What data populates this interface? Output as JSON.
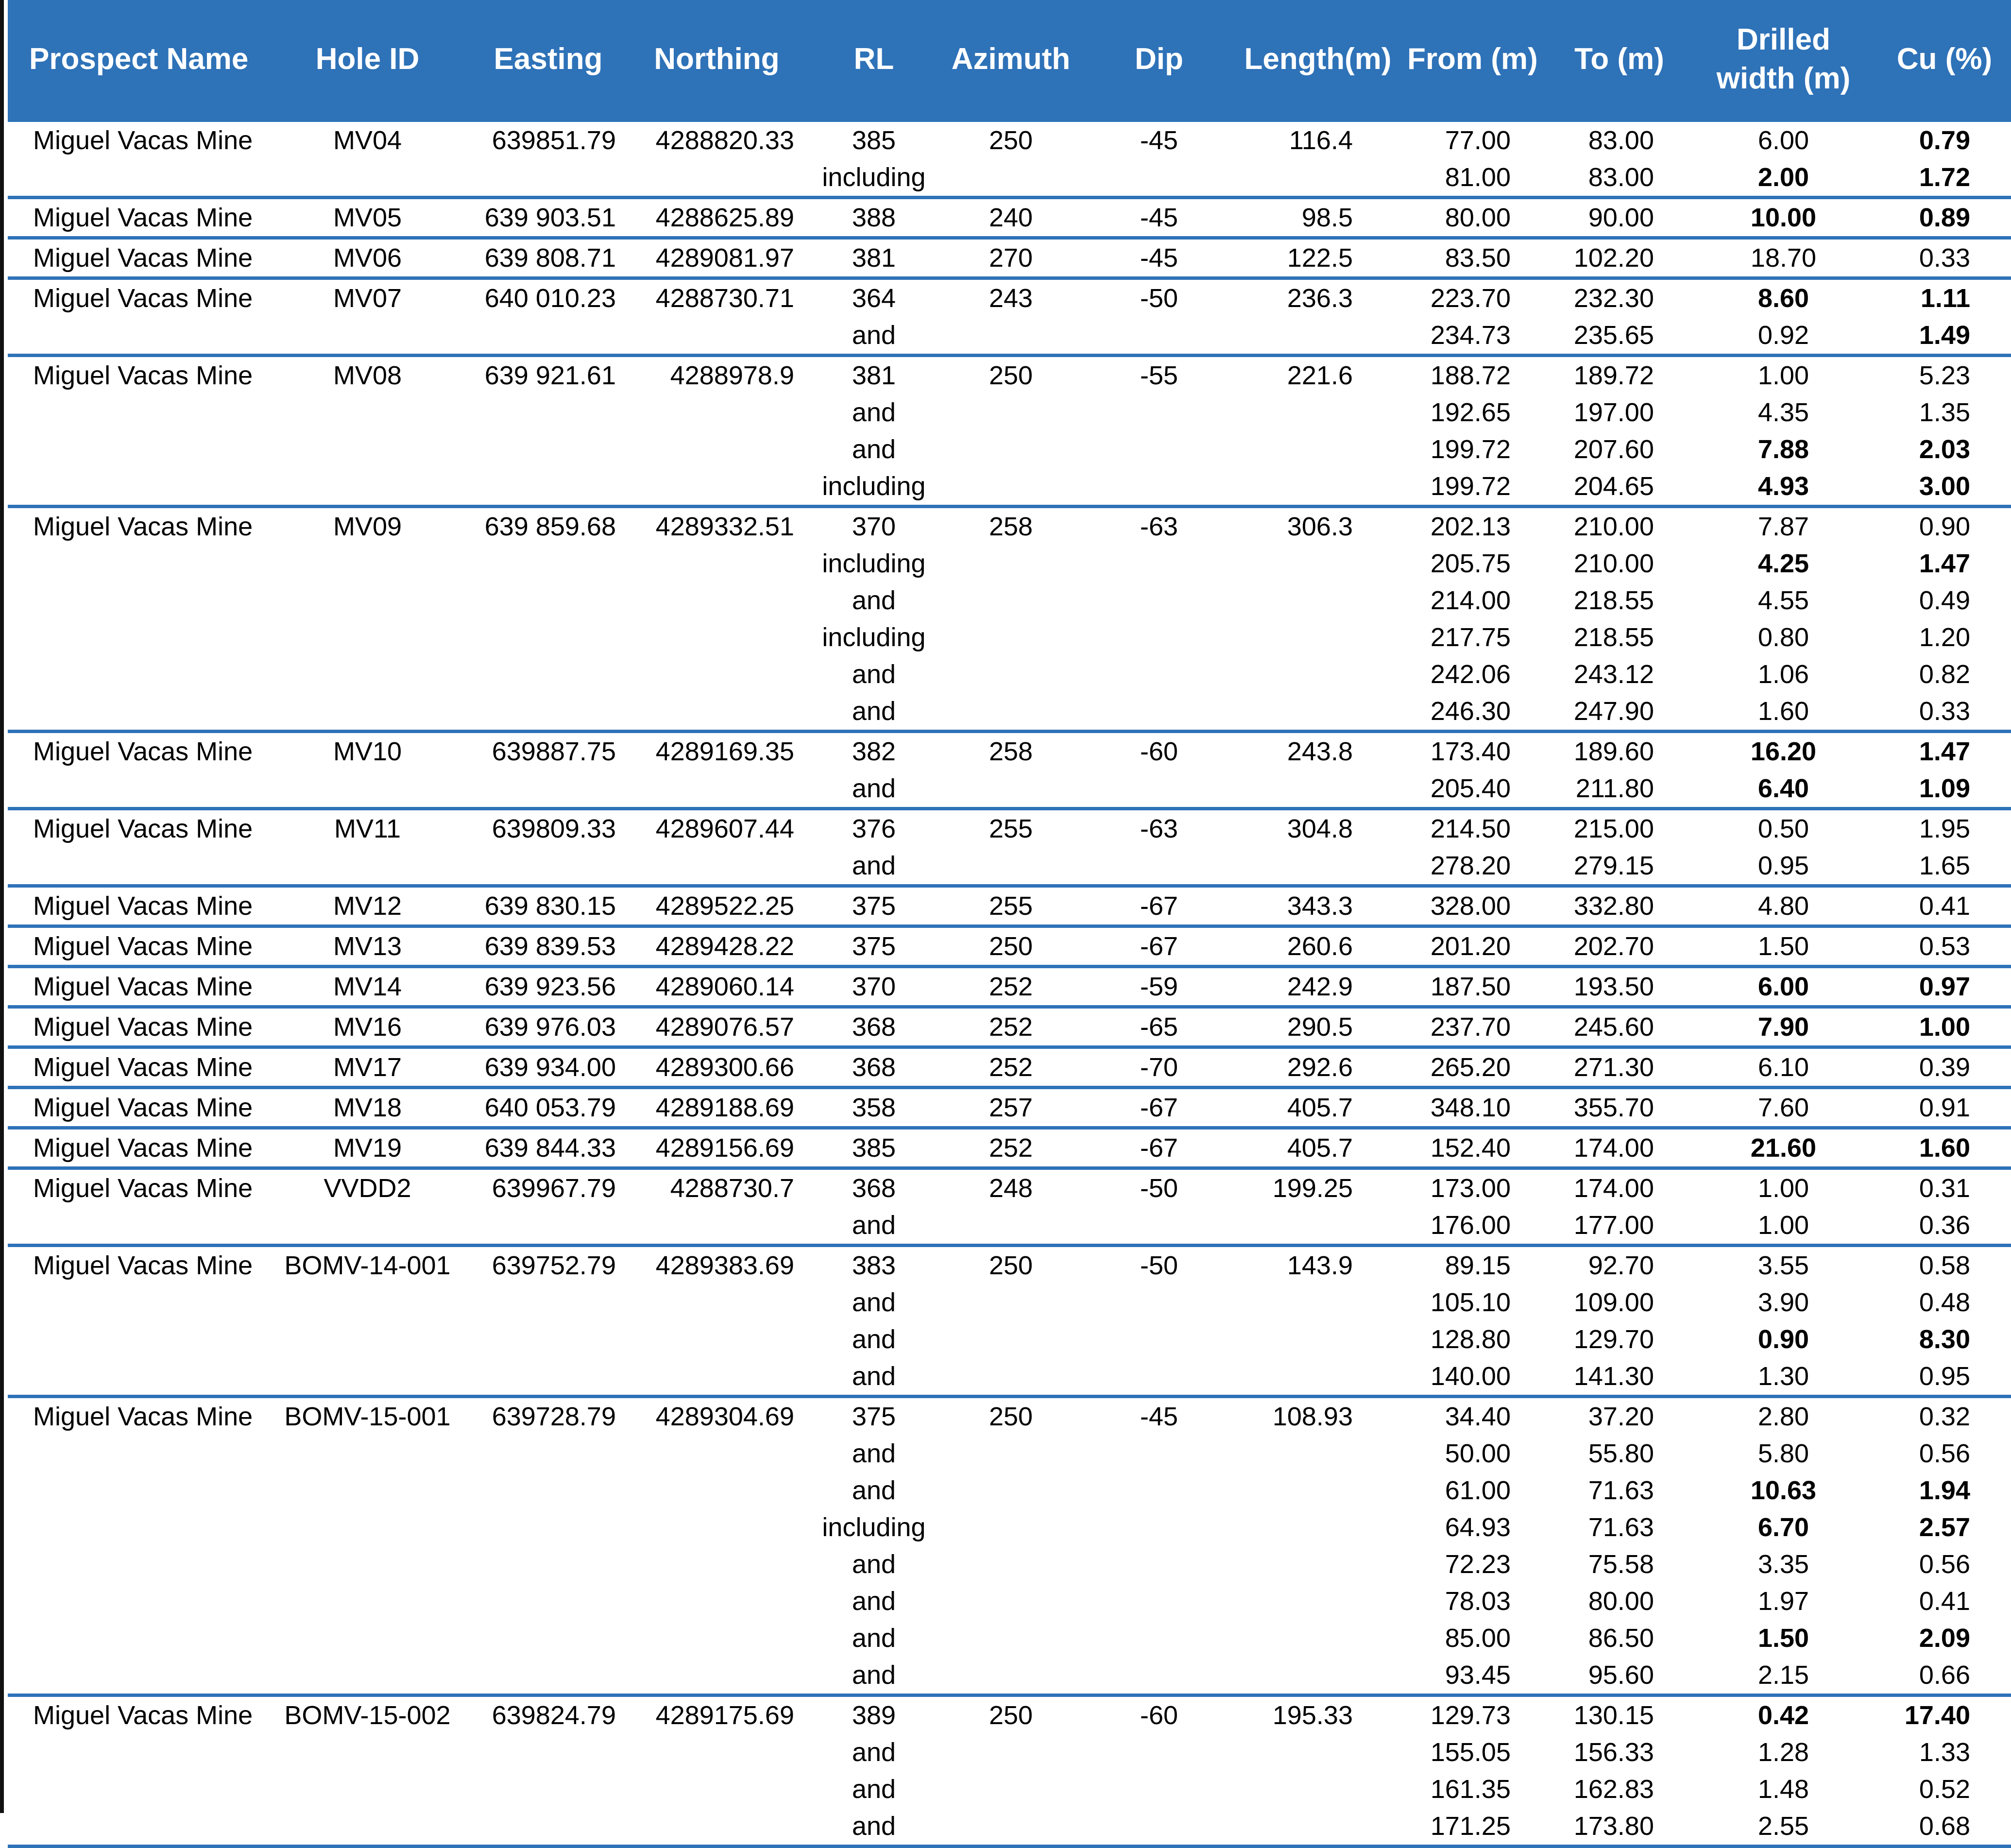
{
  "colors": {
    "header_bg": "#2e72b8",
    "header_text": "#ffffff",
    "rule": "#2e72b8"
  },
  "columns": [
    "Prospect Name",
    "Hole ID",
    "Easting",
    "Northing",
    "RL",
    "Azimuth",
    "Dip",
    "Length(m)",
    "From (m)",
    "To (m)",
    "Drilled width (m)",
    "Cu (%)"
  ],
  "holes": [
    {
      "prospect": "Miguel Vacas Mine",
      "hole_id": "MV04",
      "easting": "639851.79",
      "northing": "4288820.33",
      "rl": "385",
      "azimuth": "250",
      "dip": "-45",
      "length": "116.4",
      "intervals": [
        {
          "label": "",
          "from": "77.00",
          "to": "83.00",
          "width": "6.00",
          "cu": "0.79",
          "bw": false,
          "bc": true
        },
        {
          "label": "including",
          "from": "81.00",
          "to": "83.00",
          "width": "2.00",
          "cu": "1.72",
          "bw": true,
          "bc": true
        }
      ]
    },
    {
      "prospect": "Miguel Vacas Mine",
      "hole_id": "MV05",
      "easting": "639 903.51",
      "northing": "4288625.89",
      "rl": "388",
      "azimuth": "240",
      "dip": "-45",
      "length": "98.5",
      "intervals": [
        {
          "label": "",
          "from": "80.00",
          "to": "90.00",
          "width": "10.00",
          "cu": "0.89",
          "bw": true,
          "bc": true
        }
      ]
    },
    {
      "prospect": "Miguel Vacas Mine",
      "hole_id": "MV06",
      "easting": "639 808.71",
      "northing": "4289081.97",
      "rl": "381",
      "azimuth": "270",
      "dip": "-45",
      "length": "122.5",
      "intervals": [
        {
          "label": "",
          "from": "83.50",
          "to": "102.20",
          "width": "18.70",
          "cu": "0.33",
          "bw": false,
          "bc": false
        }
      ]
    },
    {
      "prospect": "Miguel Vacas Mine",
      "hole_id": "MV07",
      "easting": "640 010.23",
      "northing": "4288730.71",
      "rl": "364",
      "azimuth": "243",
      "dip": "-50",
      "length": "236.3",
      "intervals": [
        {
          "label": "",
          "from": "223.70",
          "to": "232.30",
          "width": "8.60",
          "cu": "1.11",
          "bw": true,
          "bc": true
        },
        {
          "label": "and",
          "from": "234.73",
          "to": "235.65",
          "width": "0.92",
          "cu": "1.49",
          "bw": false,
          "bc": true
        }
      ]
    },
    {
      "prospect": "Miguel Vacas Mine",
      "hole_id": "MV08",
      "easting": "639 921.61",
      "northing": "4288978.9",
      "rl": "381",
      "azimuth": "250",
      "dip": "-55",
      "length": "221.6",
      "intervals": [
        {
          "label": "",
          "from": "188.72",
          "to": "189.72",
          "width": "1.00",
          "cu": "5.23",
          "bw": false,
          "bc": false
        },
        {
          "label": "and",
          "from": "192.65",
          "to": "197.00",
          "width": "4.35",
          "cu": "1.35",
          "bw": false,
          "bc": false
        },
        {
          "label": "and",
          "from": "199.72",
          "to": "207.60",
          "width": "7.88",
          "cu": "2.03",
          "bw": true,
          "bc": true
        },
        {
          "label": "including",
          "from": "199.72",
          "to": "204.65",
          "width": "4.93",
          "cu": "3.00",
          "bw": true,
          "bc": true
        }
      ]
    },
    {
      "prospect": "Miguel Vacas Mine",
      "hole_id": "MV09",
      "easting": "639 859.68",
      "northing": "4289332.51",
      "rl": "370",
      "azimuth": "258",
      "dip": "-63",
      "length": "306.3",
      "intervals": [
        {
          "label": "",
          "from": "202.13",
          "to": "210.00",
          "width": "7.87",
          "cu": "0.90",
          "bw": false,
          "bc": false
        },
        {
          "label": "including",
          "from": "205.75",
          "to": "210.00",
          "width": "4.25",
          "cu": "1.47",
          "bw": true,
          "bc": true
        },
        {
          "label": "and",
          "from": "214.00",
          "to": "218.55",
          "width": "4.55",
          "cu": "0.49",
          "bw": false,
          "bc": false
        },
        {
          "label": "including",
          "from": "217.75",
          "to": "218.55",
          "width": "0.80",
          "cu": "1.20",
          "bw": false,
          "bc": false
        },
        {
          "label": "and",
          "from": "242.06",
          "to": "243.12",
          "width": "1.06",
          "cu": "0.82",
          "bw": false,
          "bc": false
        },
        {
          "label": "and",
          "from": "246.30",
          "to": "247.90",
          "width": "1.60",
          "cu": "0.33",
          "bw": false,
          "bc": false
        }
      ]
    },
    {
      "prospect": "Miguel Vacas Mine",
      "hole_id": "MV10",
      "easting": "639887.75",
      "northing": "4289169.35",
      "rl": "382",
      "azimuth": "258",
      "dip": "-60",
      "length": "243.8",
      "intervals": [
        {
          "label": "",
          "from": "173.40",
          "to": "189.60",
          "width": "16.20",
          "cu": "1.47",
          "bw": true,
          "bc": true
        },
        {
          "label": "and",
          "from": "205.40",
          "to": "211.80",
          "width": "6.40",
          "cu": "1.09",
          "bw": true,
          "bc": true
        }
      ]
    },
    {
      "prospect": "Miguel Vacas Mine",
      "hole_id": "MV11",
      "easting": "639809.33",
      "northing": "4289607.44",
      "rl": "376",
      "azimuth": "255",
      "dip": "-63",
      "length": "304.8",
      "intervals": [
        {
          "label": "",
          "from": "214.50",
          "to": "215.00",
          "width": "0.50",
          "cu": "1.95",
          "bw": false,
          "bc": false
        },
        {
          "label": "and",
          "from": "278.20",
          "to": "279.15",
          "width": "0.95",
          "cu": "1.65",
          "bw": false,
          "bc": false
        }
      ]
    },
    {
      "prospect": "Miguel Vacas Mine",
      "hole_id": "MV12",
      "easting": "639 830.15",
      "northing": "4289522.25",
      "rl": "375",
      "azimuth": "255",
      "dip": "-67",
      "length": "343.3",
      "intervals": [
        {
          "label": "",
          "from": "328.00",
          "to": "332.80",
          "width": "4.80",
          "cu": "0.41",
          "bw": false,
          "bc": false
        }
      ]
    },
    {
      "prospect": "Miguel Vacas Mine",
      "hole_id": "MV13",
      "easting": "639 839.53",
      "northing": "4289428.22",
      "rl": "375",
      "azimuth": "250",
      "dip": "-67",
      "length": "260.6",
      "intervals": [
        {
          "label": "",
          "from": "201.20",
          "to": "202.70",
          "width": "1.50",
          "cu": "0.53",
          "bw": false,
          "bc": false
        }
      ]
    },
    {
      "prospect": "Miguel Vacas Mine",
      "hole_id": "MV14",
      "easting": "639 923.56",
      "northing": "4289060.14",
      "rl": "370",
      "azimuth": "252",
      "dip": "-59",
      "length": "242.9",
      "intervals": [
        {
          "label": "",
          "from": "187.50",
          "to": "193.50",
          "width": "6.00",
          "cu": "0.97",
          "bw": true,
          "bc": true
        }
      ]
    },
    {
      "prospect": "Miguel Vacas Mine",
      "hole_id": "MV16",
      "easting": "639 976.03",
      "northing": "4289076.57",
      "rl": "368",
      "azimuth": "252",
      "dip": "-65",
      "length": "290.5",
      "intervals": [
        {
          "label": "",
          "from": "237.70",
          "to": "245.60",
          "width": "7.90",
          "cu": "1.00",
          "bw": true,
          "bc": true
        }
      ]
    },
    {
      "prospect": "Miguel Vacas Mine",
      "hole_id": "MV17",
      "easting": "639 934.00",
      "northing": "4289300.66",
      "rl": "368",
      "azimuth": "252",
      "dip": "-70",
      "length": "292.6",
      "intervals": [
        {
          "label": "",
          "from": "265.20",
          "to": "271.30",
          "width": "6.10",
          "cu": "0.39",
          "bw": false,
          "bc": false
        }
      ]
    },
    {
      "prospect": "Miguel Vacas Mine",
      "hole_id": "MV18",
      "easting": "640 053.79",
      "northing": "4289188.69",
      "rl": "358",
      "azimuth": "257",
      "dip": "-67",
      "length": "405.7",
      "intervals": [
        {
          "label": "",
          "from": "348.10",
          "to": "355.70",
          "width": "7.60",
          "cu": "0.91",
          "bw": false,
          "bc": false
        }
      ]
    },
    {
      "prospect": "Miguel Vacas Mine",
      "hole_id": "MV19",
      "easting": "639 844.33",
      "northing": "4289156.69",
      "rl": "385",
      "azimuth": "252",
      "dip": "-67",
      "length": "405.7",
      "intervals": [
        {
          "label": "",
          "from": "152.40",
          "to": "174.00",
          "width": "21.60",
          "cu": "1.60",
          "bw": true,
          "bc": true
        }
      ]
    },
    {
      "prospect": "Miguel Vacas Mine",
      "hole_id": "VVDD2",
      "easting": "639967.79",
      "northing": "4288730.7",
      "rl": "368",
      "azimuth": "248",
      "dip": "-50",
      "length": "199.25",
      "intervals": [
        {
          "label": "",
          "from": "173.00",
          "to": "174.00",
          "width": "1.00",
          "cu": "0.31",
          "bw": false,
          "bc": false
        },
        {
          "label": "and",
          "from": "176.00",
          "to": "177.00",
          "width": "1.00",
          "cu": "0.36",
          "bw": false,
          "bc": false
        }
      ]
    },
    {
      "prospect": "Miguel Vacas Mine",
      "hole_id": "BOMV-14-001",
      "easting": "639752.79",
      "northing": "4289383.69",
      "rl": "383",
      "azimuth": "250",
      "dip": "-50",
      "length": "143.9",
      "intervals": [
        {
          "label": "",
          "from": "89.15",
          "to": "92.70",
          "width": "3.55",
          "cu": "0.58",
          "bw": false,
          "bc": false
        },
        {
          "label": "and",
          "from": "105.10",
          "to": "109.00",
          "width": "3.90",
          "cu": "0.48",
          "bw": false,
          "bc": false
        },
        {
          "label": "and",
          "from": "128.80",
          "to": "129.70",
          "width": "0.90",
          "cu": "8.30",
          "bw": true,
          "bc": true
        },
        {
          "label": "and",
          "from": "140.00",
          "to": "141.30",
          "width": "1.30",
          "cu": "0.95",
          "bw": false,
          "bc": false
        }
      ]
    },
    {
      "prospect": "Miguel Vacas Mine",
      "hole_id": "BOMV-15-001",
      "easting": "639728.79",
      "northing": "4289304.69",
      "rl": "375",
      "azimuth": "250",
      "dip": "-45",
      "length": "108.93",
      "intervals": [
        {
          "label": "",
          "from": "34.40",
          "to": "37.20",
          "width": "2.80",
          "cu": "0.32",
          "bw": false,
          "bc": false
        },
        {
          "label": "and",
          "from": "50.00",
          "to": "55.80",
          "width": "5.80",
          "cu": "0.56",
          "bw": false,
          "bc": false
        },
        {
          "label": "and",
          "from": "61.00",
          "to": "71.63",
          "width": "10.63",
          "cu": "1.94",
          "bw": true,
          "bc": true
        },
        {
          "label": "including",
          "from": "64.93",
          "to": "71.63",
          "width": "6.70",
          "cu": "2.57",
          "bw": true,
          "bc": true
        },
        {
          "label": "and",
          "from": "72.23",
          "to": "75.58",
          "width": "3.35",
          "cu": "0.56",
          "bw": false,
          "bc": false
        },
        {
          "label": "and",
          "from": "78.03",
          "to": "80.00",
          "width": "1.97",
          "cu": "0.41",
          "bw": false,
          "bc": false
        },
        {
          "label": "and",
          "from": "85.00",
          "to": "86.50",
          "width": "1.50",
          "cu": "2.09",
          "bw": true,
          "bc": true
        },
        {
          "label": "and",
          "from": "93.45",
          "to": "95.60",
          "width": "2.15",
          "cu": "0.66",
          "bw": false,
          "bc": false
        }
      ]
    },
    {
      "prospect": "Miguel Vacas Mine",
      "hole_id": "BOMV-15-002",
      "easting": "639824.79",
      "northing": "4289175.69",
      "rl": "389",
      "azimuth": "250",
      "dip": "-60",
      "length": "195.33",
      "intervals": [
        {
          "label": "",
          "from": "129.73",
          "to": "130.15",
          "width": "0.42",
          "cu": "17.40",
          "bw": true,
          "bc": true
        },
        {
          "label": "and",
          "from": "155.05",
          "to": "156.33",
          "width": "1.28",
          "cu": "1.33",
          "bw": false,
          "bc": false
        },
        {
          "label": "and",
          "from": "161.35",
          "to": "162.83",
          "width": "1.48",
          "cu": "0.52",
          "bw": false,
          "bc": false
        },
        {
          "label": "and",
          "from": "171.25",
          "to": "173.80",
          "width": "2.55",
          "cu": "0.68",
          "bw": false,
          "bc": false
        }
      ]
    }
  ]
}
